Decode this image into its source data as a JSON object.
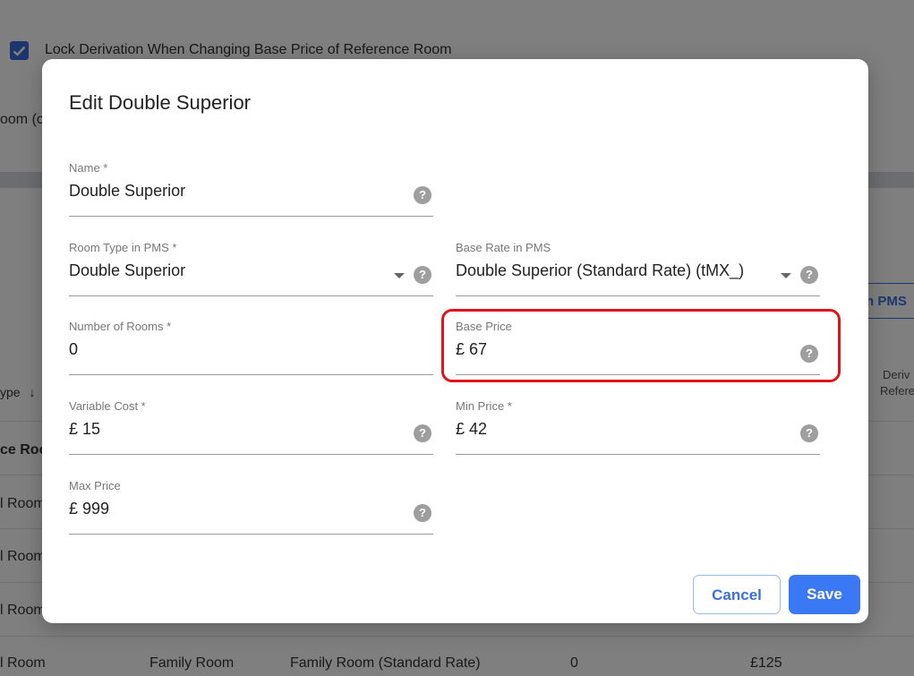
{
  "background": {
    "lock_label": "Lock Derivation When Changing Base Price of Reference Room",
    "room_partial": "oom (c",
    "type_header": "ype",
    "sort_arrow": "↓",
    "pms_button": "n PMS",
    "deriv_header_1": "Deriv",
    "deriv_header_2": "Refere",
    "rows": [
      "ce Roo",
      "l Room",
      "l Room",
      "l Room"
    ],
    "last_row": {
      "room": "l Room",
      "type": "Family Room",
      "rate": "Family Room (Standard Rate)",
      "count": "0",
      "price": "£125"
    }
  },
  "modal": {
    "title": "Edit Double Superior",
    "fields": {
      "name": {
        "label": "Name *",
        "value": "Double Superior"
      },
      "room_type": {
        "label": "Room Type in PMS *",
        "value": "Double Superior"
      },
      "base_rate": {
        "label": "Base Rate in PMS",
        "value": "Double Superior (Standard Rate) (tMX_)"
      },
      "rooms": {
        "label": "Number of Rooms *",
        "value": "0"
      },
      "base_price": {
        "label": "Base Price",
        "value": "£ 67"
      },
      "variable_cost": {
        "label": "Variable Cost *",
        "value": "£ 15"
      },
      "min_price": {
        "label": "Min Price *",
        "value": "£ 42"
      },
      "max_price": {
        "label": "Max Price",
        "value": "£ 999"
      }
    },
    "help_glyph": "?",
    "cancel_label": "Cancel",
    "save_label": "Save"
  },
  "colors": {
    "accent": "#3b78f4",
    "highlight": "#e0141c"
  }
}
